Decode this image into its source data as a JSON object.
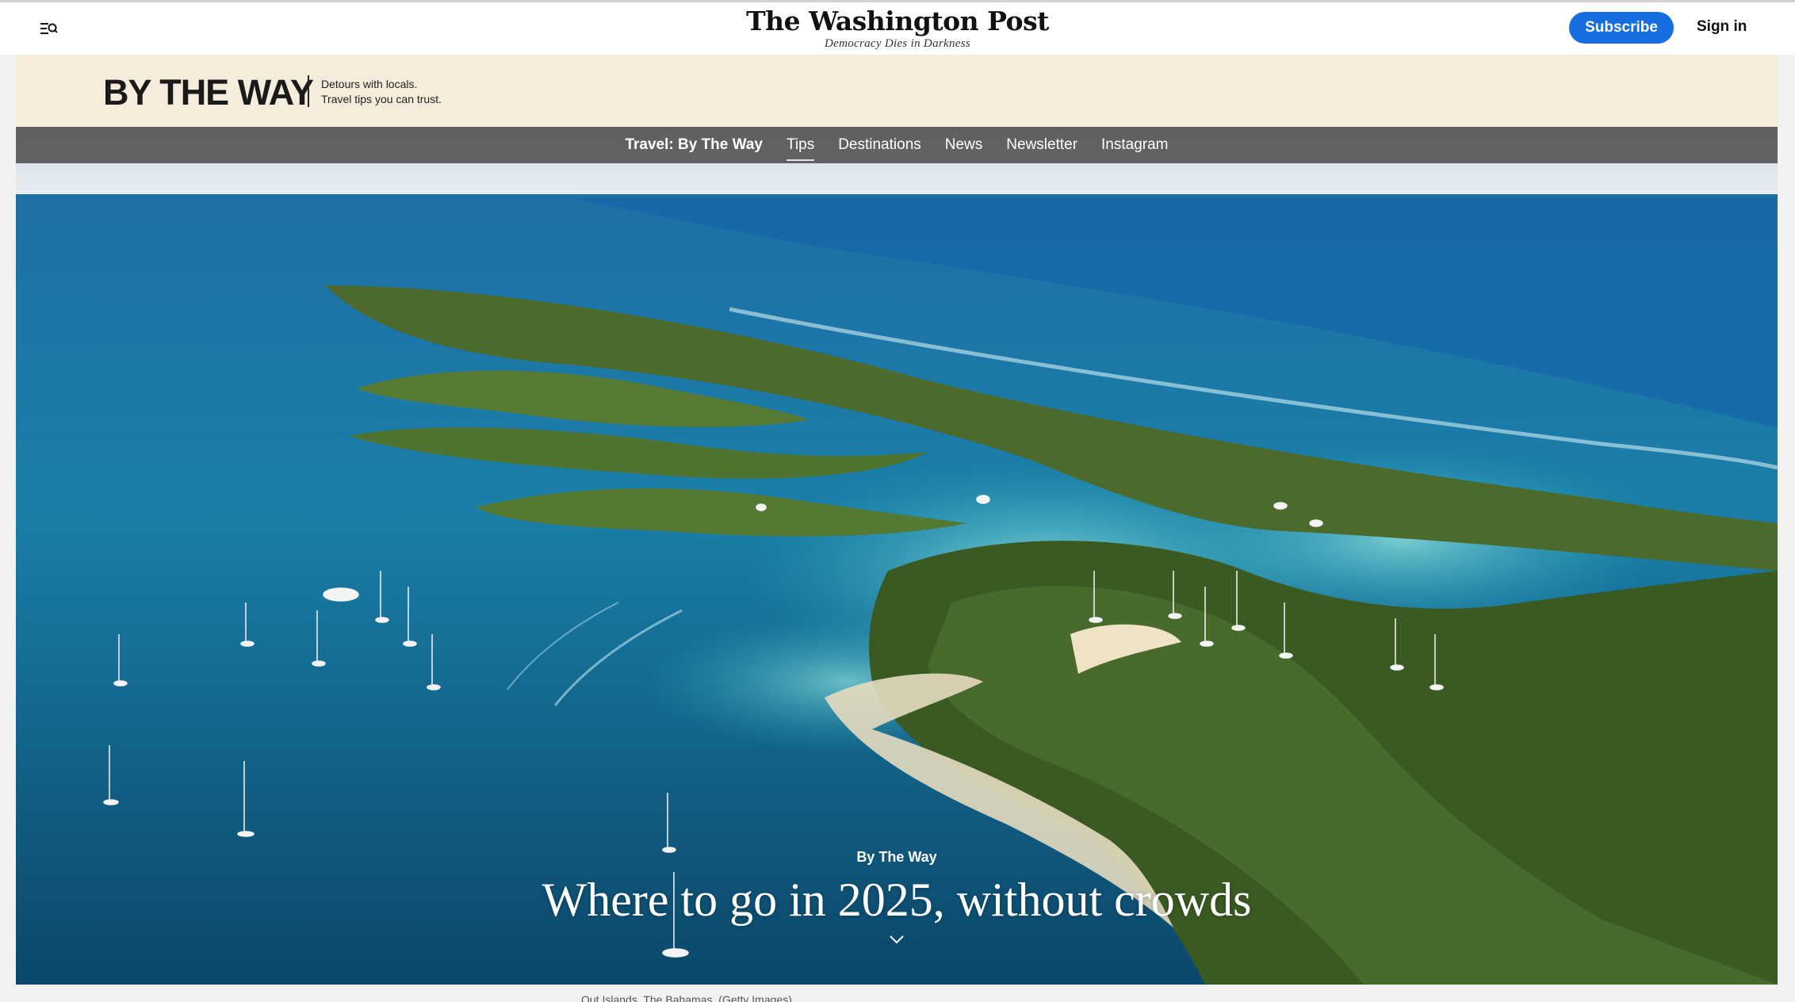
{
  "header": {
    "masthead_title": "The Washington Post",
    "masthead_tagline": "Democracy Dies in Darkness",
    "subscribe_label": "Subscribe",
    "signin_label": "Sign in",
    "menu_icon": "menu-search-icon"
  },
  "section_banner": {
    "logo_text": "BY THE WAY",
    "tagline_line1": "Detours with locals.",
    "tagline_line2": "Travel tips you can trust."
  },
  "section_nav": {
    "items": [
      {
        "label": "Travel: By The Way",
        "active": false,
        "brand": true
      },
      {
        "label": "Tips",
        "active": true
      },
      {
        "label": "Destinations",
        "active": false
      },
      {
        "label": "News",
        "active": false
      },
      {
        "label": "Newsletter",
        "active": false
      },
      {
        "label": "Instagram",
        "active": false
      }
    ]
  },
  "hero": {
    "kicker": "By The Way",
    "headline": "Where to go in 2025, without crowds",
    "scroll_icon": "chevron-down-icon",
    "caption": "Out Islands, The Bahamas. (Getty Images)"
  },
  "colors": {
    "subscribe_blue": "#166de0",
    "banner_cream": "#f6ecdc",
    "nav_bar": "#464646"
  }
}
